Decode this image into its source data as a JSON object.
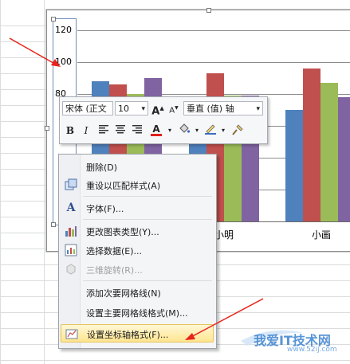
{
  "chart": {
    "y_ticks": [
      "120",
      "100",
      "80"
    ],
    "x_categories": [
      "小明",
      "小画"
    ],
    "colors": {
      "blue": "#4f81bd",
      "red": "#c0504d",
      "green": "#9bbb59",
      "purple": "#8064a2"
    }
  },
  "chart_data": {
    "type": "bar",
    "categories": [
      "",
      "小明",
      "小画"
    ],
    "series": [
      {
        "values": [
          88,
          78,
          70
        ]
      },
      {
        "values": [
          86,
          93,
          96
        ]
      },
      {
        "values": [
          80,
          79,
          87
        ]
      },
      {
        "values": [
          90,
          79,
          78
        ]
      }
    ],
    "ylim": [
      0,
      120
    ],
    "y_ticks": [
      "120",
      "100",
      "80"
    ]
  },
  "mini_toolbar": {
    "font_name": "宋体 (正文",
    "font_size": "10",
    "grow_font": "A",
    "shrink_font": "A",
    "element_select": "垂直 (值) 轴",
    "bold": "B",
    "italic": "I",
    "font_color": "A"
  },
  "context_menu": {
    "items": [
      {
        "label": "删除(D)",
        "icon": "none"
      },
      {
        "label": "重设以匹配样式(A)",
        "icon": "reset-style-icon"
      },
      {
        "label": "字体(F)...",
        "icon": "font-icon"
      },
      {
        "label": "更改图表类型(Y)...",
        "icon": "chart-type-icon"
      },
      {
        "label": "选择数据(E)...",
        "icon": "select-data-icon"
      },
      {
        "label": "三维旋转(R)...",
        "icon": "3d-rotate-icon"
      },
      {
        "label": "添加次要网格线(N)",
        "icon": "none"
      },
      {
        "label": "设置主要网格线格式(M)...",
        "icon": "none"
      },
      {
        "label": "设置坐标轴格式(F)...",
        "icon": "format-axis-icon"
      }
    ]
  },
  "watermark": {
    "text": "我爱IT技术网",
    "url": "www.52ij.com"
  }
}
